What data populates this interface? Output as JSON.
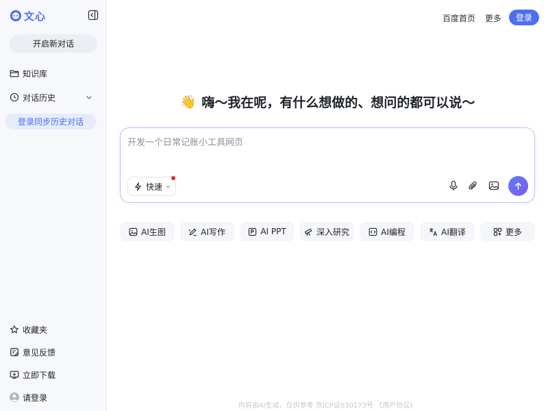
{
  "brand": {
    "name": "文心",
    "color": "#4e6ef2"
  },
  "sidebar": {
    "collapse_icon": "sidebar-collapse-icon",
    "new_chat_label": "开启新对话",
    "items": [
      {
        "label": "知识库",
        "icon": "folder-icon"
      },
      {
        "label": "对话历史",
        "icon": "clock-icon"
      }
    ],
    "sync_label": "登录同步历史对话",
    "bottom_items": [
      {
        "label": "收藏夹",
        "icon": "star-icon"
      },
      {
        "label": "意见反馈",
        "icon": "feedback-icon"
      },
      {
        "label": "立即下载",
        "icon": "download-icon"
      },
      {
        "label": "请登录",
        "icon": "avatar-icon"
      }
    ]
  },
  "header": {
    "links": [
      "百度首页",
      "更多"
    ],
    "login_label": "登录"
  },
  "greeting": {
    "emoji": "👋",
    "text": "嗨～我在呢，有什么想做的、想问的都可以说～"
  },
  "composer": {
    "placeholder": "开发一个日常记账小工具网页",
    "mode_label": "快速",
    "tools": [
      "microphone-icon",
      "paperclip-icon",
      "image-icon"
    ],
    "send_icon": "arrow-up-icon"
  },
  "quick_actions": [
    {
      "label": "AI生图",
      "icon": "image-gen-icon"
    },
    {
      "label": "AI写作",
      "icon": "pen-icon"
    },
    {
      "label": "AI PPT",
      "icon": "ppt-icon"
    },
    {
      "label": "深入研究",
      "icon": "telescope-icon"
    },
    {
      "label": "AI编程",
      "icon": "code-icon"
    },
    {
      "label": "AI翻译",
      "icon": "translate-icon"
    },
    {
      "label": "更多",
      "icon": "grid-icon"
    }
  ],
  "footer": {
    "text": "内容由AI生成，仅供参考  京ICP证030173号  《用户协议》"
  }
}
